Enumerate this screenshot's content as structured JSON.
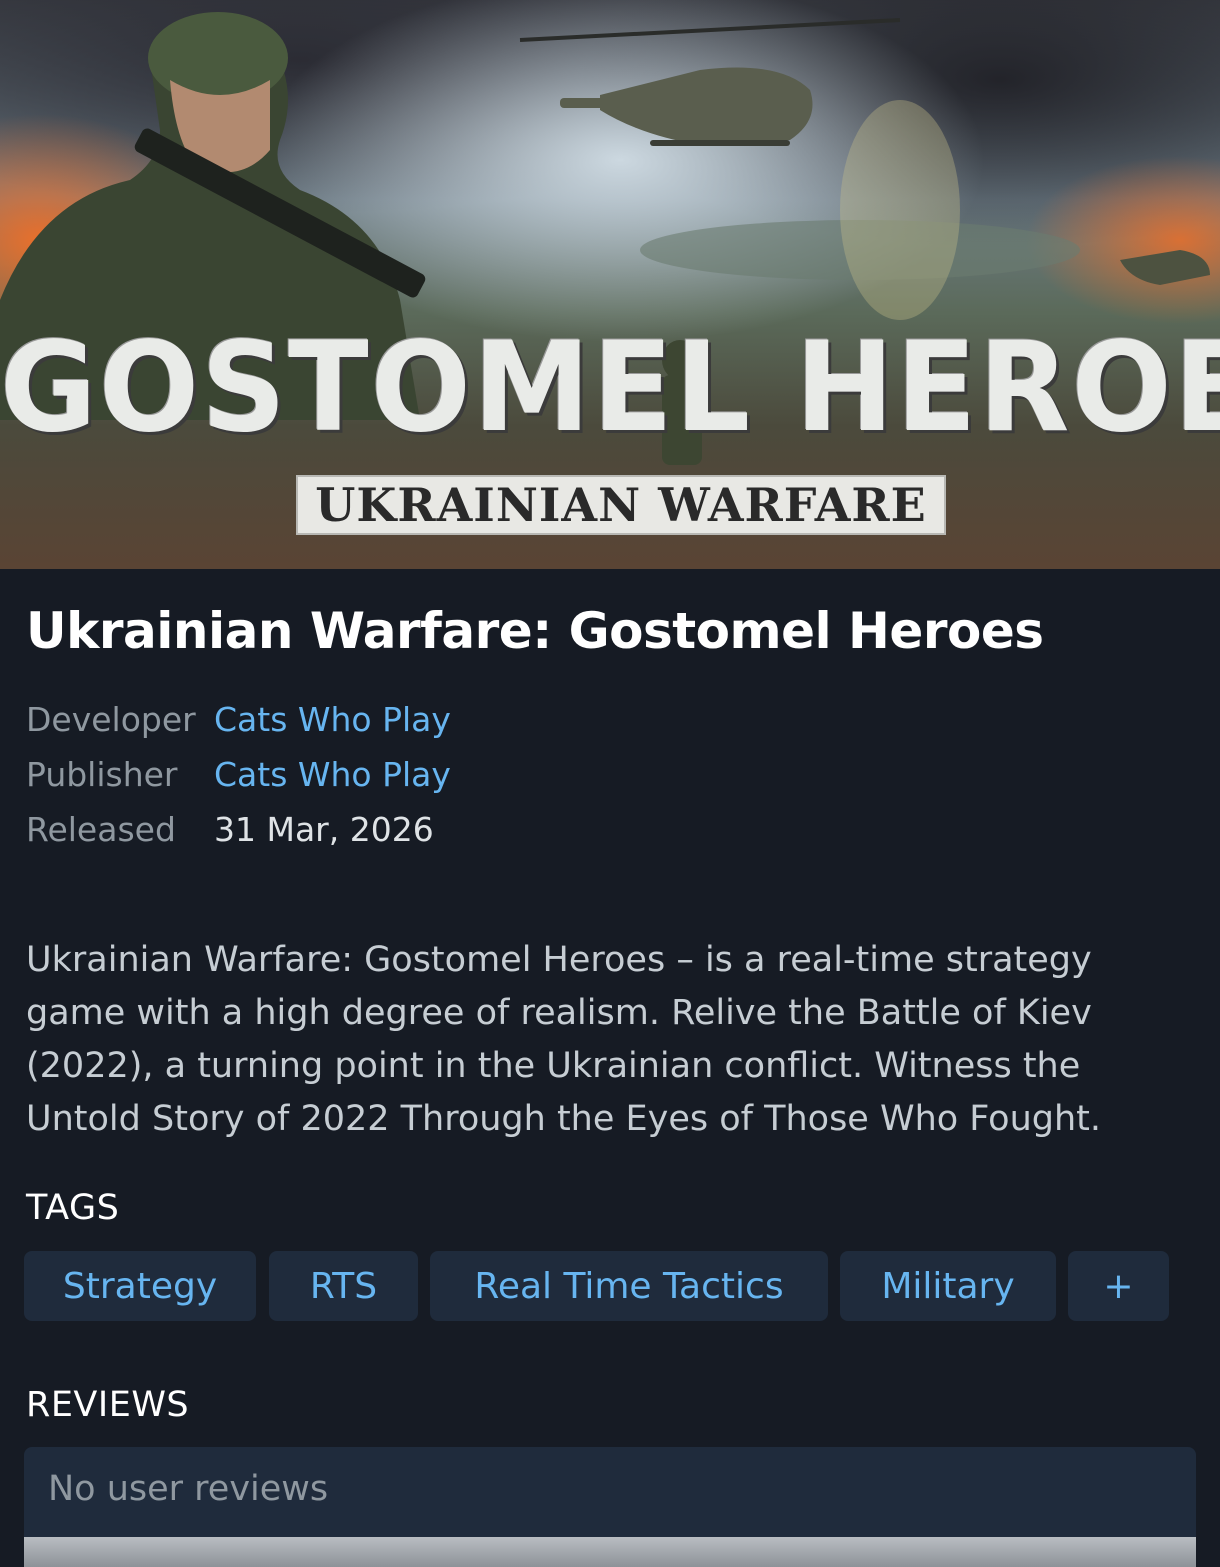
{
  "hero": {
    "logo_main": "GOSTOMEL HEROES",
    "logo_sub": "UKRAINIAN WARFARE"
  },
  "game": {
    "title": "Ukrainian Warfare: Gostomel Heroes",
    "developer_label": "Developer",
    "developer": "Cats Who Play",
    "publisher_label": "Publisher",
    "publisher": "Cats Who Play",
    "released_label": "Released",
    "released": "31 Mar, 2026",
    "description": "Ukrainian Warfare: Gostomel Heroes – is a real-time strategy game with a high degree of realism. Relive the Battle of Kiev (2022), a turning point in the Ukrainian conflict. Witness the Untold Story of 2022 Through the Eyes of Those Who Fought."
  },
  "tags": {
    "heading": "TAGS",
    "items": [
      "Strategy",
      "RTS",
      "Real Time Tactics",
      "Military",
      "+"
    ]
  },
  "reviews": {
    "heading": "REVIEWS",
    "empty_text": "No user reviews"
  },
  "colors": {
    "background": "#161b24",
    "link": "#67b5f0",
    "tag_bg": "#1f2b3c",
    "muted": "#8f98a0"
  }
}
